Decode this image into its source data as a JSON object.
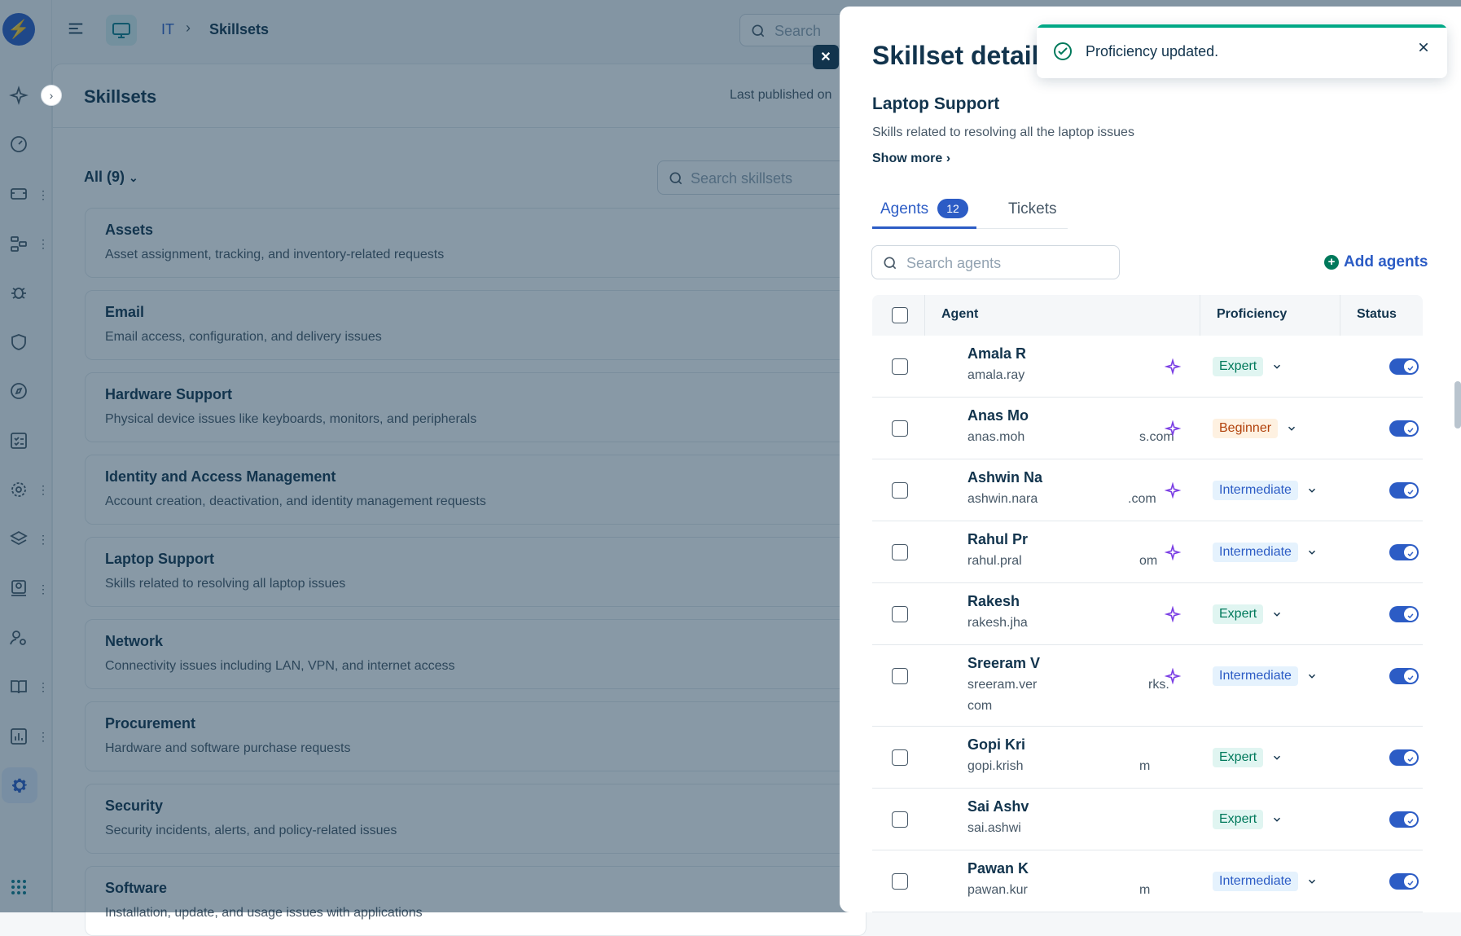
{
  "topbar": {
    "breadcrumb_root": "IT",
    "breadcrumb_current": "Skillsets",
    "search_placeholder": "Search"
  },
  "page": {
    "title": "Skillsets",
    "last_published": "Last published on",
    "filter_label": "All (9)",
    "search_placeholder": "Search skillsets"
  },
  "skillsets": [
    {
      "name": "Assets",
      "description": "Asset assignment, tracking, and inventory-related requests"
    },
    {
      "name": "Email",
      "description": "Email access, configuration, and delivery issues"
    },
    {
      "name": "Hardware Support",
      "description": "Physical device issues like keyboards, monitors, and peripherals"
    },
    {
      "name": "Identity and Access Management",
      "description": "Account creation, deactivation, and identity management requests"
    },
    {
      "name": "Laptop Support",
      "description": "Skills related to resolving all laptop issues"
    },
    {
      "name": "Network",
      "description": "Connectivity issues including LAN, VPN, and internet access"
    },
    {
      "name": "Procurement",
      "description": "Hardware and software purchase requests"
    },
    {
      "name": "Security",
      "description": "Security incidents, alerts, and policy-related issues"
    },
    {
      "name": "Software",
      "description": "Installation, update, and usage issues with applications"
    }
  ],
  "drawer": {
    "title": "Skillset details",
    "skillset_name": "Laptop Support",
    "skillset_description": "Skills related to resolving all the laptop issues",
    "show_more": "Show more",
    "tabs": {
      "agents": "Agents",
      "agents_count": "12",
      "tickets": "Tickets"
    },
    "agent_search_placeholder": "Search agents",
    "add_agents": "Add agents",
    "columns": {
      "agent": "Agent",
      "proficiency": "Proficiency",
      "status": "Status"
    },
    "agents": [
      {
        "name": "Amala R",
        "email": "amala.ray",
        "email_tail": "",
        "proficiency": "Expert",
        "level": "expert",
        "ai": true,
        "active": true
      },
      {
        "name": "Anas Mo",
        "email": "anas.moh",
        "email_tail": "s.com",
        "proficiency": "Beginner",
        "level": "beginner",
        "ai": true,
        "active": true
      },
      {
        "name": "Ashwin Na",
        "email": "ashwin.nara",
        "email_tail": ".com",
        "proficiency": "Intermediate",
        "level": "intermediate",
        "ai": true,
        "active": true
      },
      {
        "name": "Rahul Pr",
        "email": "rahul.pral",
        "email_tail": "om",
        "proficiency": "Intermediate",
        "level": "intermediate",
        "ai": true,
        "active": true
      },
      {
        "name": "Rakesh",
        "email": "rakesh.jha",
        "email_tail": "",
        "proficiency": "Expert",
        "level": "expert",
        "ai": true,
        "active": true
      },
      {
        "name": "Sreeram V",
        "email": "sreeram.ver",
        "email_tail": "rks.",
        "email_line2": "com",
        "proficiency": "Intermediate",
        "level": "intermediate",
        "ai": true,
        "active": true
      },
      {
        "name": "Gopi Kri",
        "email": "gopi.krish",
        "email_tail": "m",
        "proficiency": "Expert",
        "level": "expert",
        "ai": false,
        "active": true
      },
      {
        "name": "Sai Ashv",
        "email": "sai.ashwi",
        "email_tail": "",
        "proficiency": "Expert",
        "level": "expert",
        "ai": false,
        "active": true
      },
      {
        "name": "Pawan K",
        "email": "pawan.kur",
        "email_tail": "m",
        "proficiency": "Intermediate",
        "level": "intermediate",
        "ai": false,
        "active": true
      }
    ]
  },
  "toast": {
    "message": "Proficiency updated."
  },
  "colors": {
    "primary": "#2c5cc5",
    "success": "#00a886",
    "ai": "#7b3fe4"
  }
}
